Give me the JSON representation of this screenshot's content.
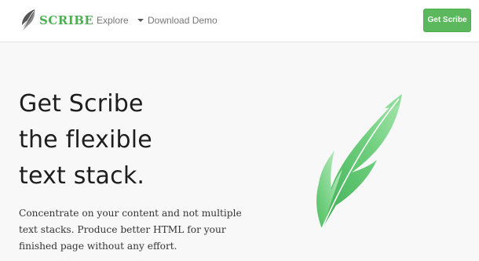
{
  "brand": {
    "name": "SCRIBE",
    "logo_icon": "feather-icon",
    "accent_color": "#4caf50"
  },
  "nav": {
    "explore_label": "Explore",
    "demo_label": "Download Demo",
    "cta_label": "Get Scribe",
    "cta_color": "#5cb85c"
  },
  "hero": {
    "title_lines": [
      "Get Scribe",
      "the flexible",
      "text stack."
    ],
    "description": "Concentrate on your content and not multiple text stacks. Produce better HTML for your finished page without any effort.",
    "illustration": "feather-icon"
  }
}
